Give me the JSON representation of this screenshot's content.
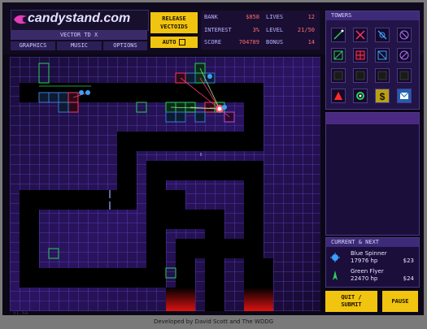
{
  "brand": {
    "logo_text": "candystand.com",
    "subtitle": "VECTOR TD X"
  },
  "menu": {
    "graphics": "GRAPHICS",
    "music": "MUSIC",
    "options": "OPTIONS"
  },
  "controls": {
    "release_line1": "RELEASE",
    "release_line2": "VECTOIDS",
    "auto": "AUTO"
  },
  "stats": {
    "bank_label": "BANK",
    "bank_value": "$858",
    "lives_label": "LIVES",
    "lives_value": "12",
    "interest_label": "INTEREST",
    "interest_value": "3%",
    "level_label": "LEVEL",
    "level_value": "21/50",
    "score_label": "SCORE",
    "score_value": "704789",
    "bonus_label": "BONUS",
    "bonus_value": "14"
  },
  "towers_panel": {
    "title": "TOWERS"
  },
  "current_panel": {
    "title": "CURRENT & NEXT",
    "current": {
      "name": "Blue Spinner",
      "hp": "17976 hp",
      "price": "$23"
    },
    "next": {
      "name": "Green Flyer",
      "hp": "22470 hp",
      "price": "$24"
    }
  },
  "buttons": {
    "quit_line1": "QUIT /",
    "quit_line2": "SUBMIT",
    "pause": "PAUSE"
  },
  "footer": "Developed by David Scott and The WDDG",
  "version": "v1.5a",
  "colors": {
    "accent_yellow": "#f1c40f",
    "grid_line": "#6a4fd0",
    "path": "#000000",
    "enemy_blue": "#3aa0ff",
    "beam_red": "#ff3366"
  }
}
